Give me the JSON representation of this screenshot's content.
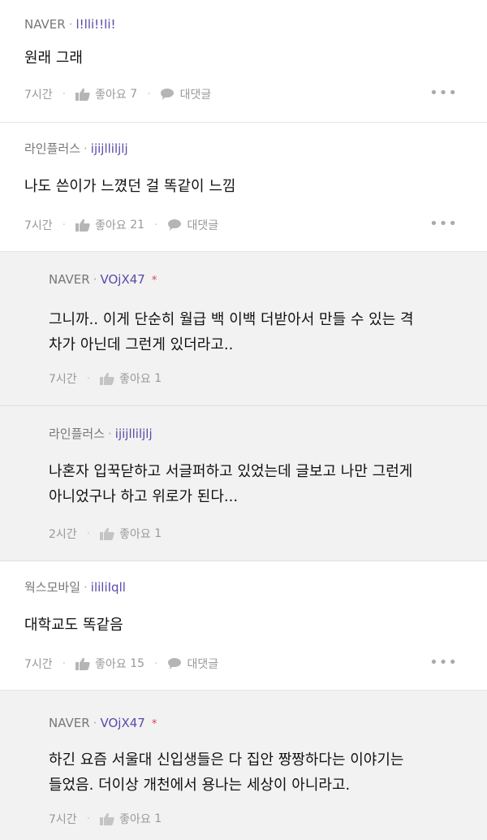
{
  "comments": [
    {
      "source": "NAVER",
      "user_id": "l!lli!!li!",
      "text": "원래 그래",
      "time": "7시간",
      "like_label": "좋아요",
      "like_count": "7",
      "reply_label": "대댓글",
      "more": "•••",
      "kind": "top"
    },
    {
      "source": "라인플러스",
      "user_id": "ijijlliljlj",
      "text": "나도 쓴이가 느꼈던 걸 똑같이 느낌",
      "time": "7시간",
      "like_label": "좋아요",
      "like_count": "21",
      "reply_label": "대댓글",
      "more": "•••",
      "kind": "top"
    },
    {
      "source": "NAVER",
      "user_id": "VOjX47",
      "star": "*",
      "text": "그니까.. 이게 단순히 월급 백 이백 더받아서 만들 수 있는 격\n차가 아닌데 그런게 있더라고..",
      "time": "7시간",
      "like_label": "좋아요",
      "like_count": "1",
      "kind": "reply"
    },
    {
      "source": "라인플러스",
      "user_id": "ijijlliljlj",
      "text": "나혼자 입꾹닫하고 서글퍼하고 있었는데 글보고 나만 그런게\n아니었구나 하고 위로가 된다...",
      "time": "2시간",
      "like_label": "좋아요",
      "like_count": "1",
      "kind": "reply"
    },
    {
      "source": "웍스모바일",
      "user_id": "ililiIqll",
      "text": "대학교도 똑같음",
      "time": "7시간",
      "like_label": "좋아요",
      "like_count": "15",
      "reply_label": "대댓글",
      "more": "•••",
      "kind": "top"
    },
    {
      "source": "NAVER",
      "user_id": "VOjX47",
      "star": "*",
      "text": "하긴 요즘 서울대 신입생들은 다 집안 짱짱하다는 이야기는\n들었음. 더이상 개천에서 용나는 세상이 아니라고.",
      "time": "7시간",
      "like_label": "좋아요",
      "like_count": "1",
      "kind": "reply"
    }
  ]
}
